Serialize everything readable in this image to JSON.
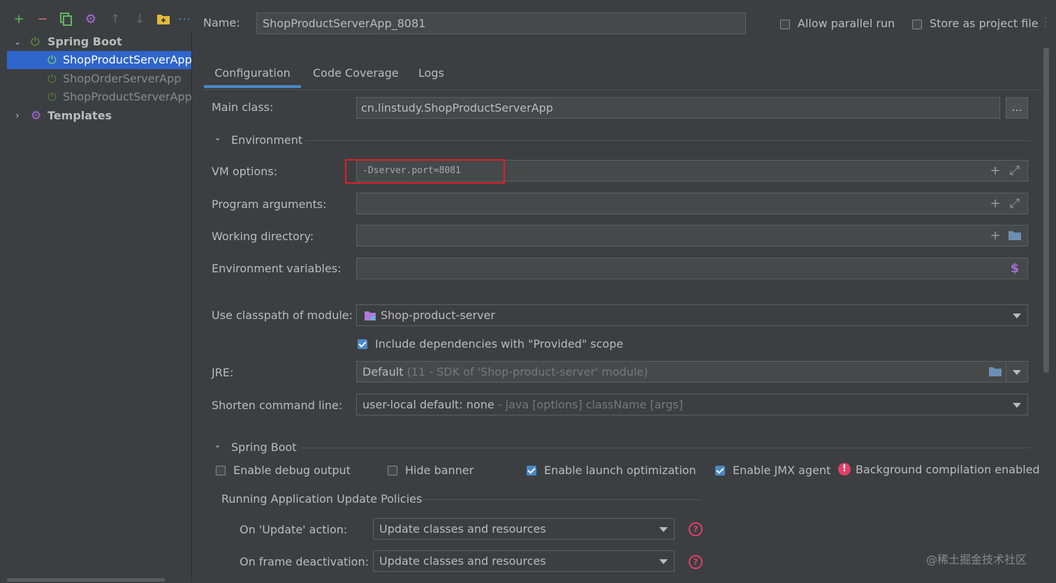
{
  "toolbar": {
    "icons": [
      "add-icon",
      "remove-icon",
      "copy-icon",
      "settings-icon",
      "move-up-icon",
      "move-down-icon",
      "folder-add-icon",
      "more-icon"
    ]
  },
  "tree": {
    "group_label": "Spring Boot",
    "items": [
      {
        "label": "ShopProductServerApp_"
      },
      {
        "label": "ShopOrderServerApp"
      },
      {
        "label": "ShopProductServerApp"
      }
    ],
    "templates_label": "Templates"
  },
  "header": {
    "name_label": "Name:",
    "name_value": "ShopProductServerApp_8081",
    "allow_parallel_label": "Allow parallel run",
    "store_project_label": "Store as project file"
  },
  "tabs": [
    "Configuration",
    "Code Coverage",
    "Logs"
  ],
  "form": {
    "main_class_label": "Main class:",
    "main_class_value": "cn.linstudy.ShopProductServerApp",
    "browse_label": "...",
    "environment_label": "Environment",
    "vm_options_label": "VM options:",
    "vm_options_value": "-Dserver.port=8081",
    "program_args_label": "Program arguments:",
    "working_dir_label": "Working directory:",
    "env_vars_label": "Environment variables:",
    "env_vars_icon": "$",
    "classpath_label": "Use classpath of module:",
    "classpath_value": "Shop-product-server",
    "include_deps_label": "Include dependencies with \"Provided\" scope",
    "jre_label": "JRE:",
    "jre_value": "Default",
    "jre_hint": "(11 - SDK of 'Shop-product-server' module)",
    "shorten_label": "Shorten command line:",
    "shorten_value": "user-local default: none",
    "shorten_hint": "- java [options] className [args]"
  },
  "spring_boot": {
    "section_label": "Spring Boot",
    "debug_label": "Enable debug output",
    "hide_banner_label": "Hide banner",
    "launch_opt_label": "Enable launch optimization",
    "jmx_label": "Enable JMX agent",
    "bg_compile_label": "Background compilation enabled",
    "update_policies_label": "Running Application Update Policies",
    "on_update_label": "On 'Update' action:",
    "on_update_value": "Update classes and resources",
    "on_frame_label": "On frame deactivation:",
    "on_frame_value": "Update classes and resources"
  },
  "watermark": "@稀土掘金技术社区",
  "colors": {
    "background": "#3c3f41",
    "selection": "#2f65ca",
    "field_bg": "#45494a",
    "accent_blue": "#4a88c7",
    "highlight_box": "#e0202a",
    "spring_green": "#6a9f3a"
  }
}
